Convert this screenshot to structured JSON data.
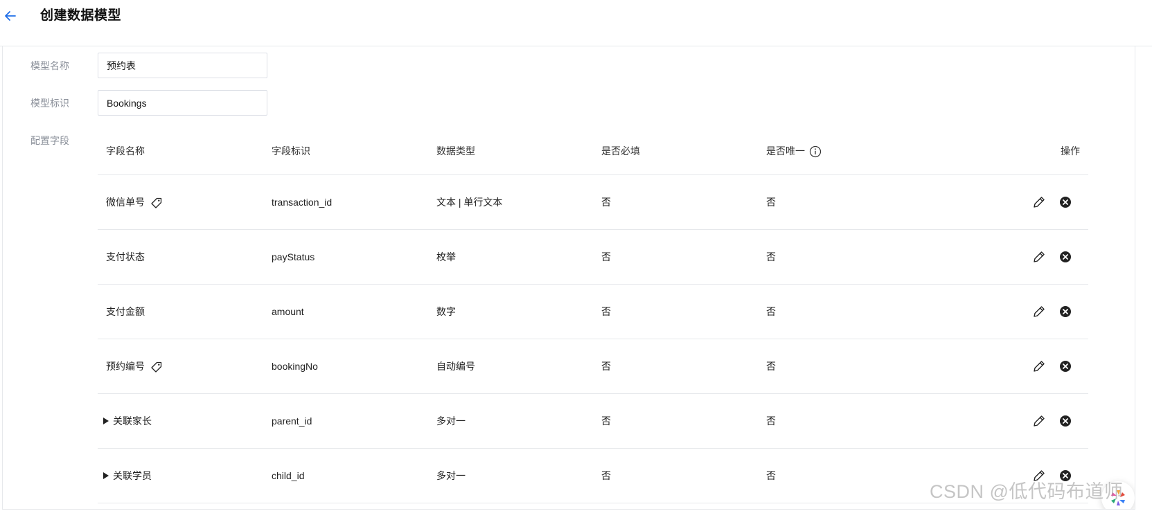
{
  "header": {
    "title": "创建数据模型",
    "back_icon": "arrow-left-icon"
  },
  "form": {
    "model_name": {
      "label": "模型名称",
      "value": "预约表"
    },
    "model_id": {
      "label": "模型标识",
      "value": "Bookings"
    },
    "fields_label": "配置字段"
  },
  "table": {
    "columns": {
      "name": "字段名称",
      "id": "字段标识",
      "type": "数据类型",
      "required": "是否必填",
      "unique": "是否唯一",
      "ops": "操作"
    },
    "rows": [
      {
        "name": "微信单号",
        "id": "transaction_id",
        "type": "文本 | 单行文本",
        "required": "否",
        "unique": "否",
        "tag": true,
        "expandable": false
      },
      {
        "name": "支付状态",
        "id": "payStatus",
        "type": "枚举",
        "required": "否",
        "unique": "否",
        "tag": false,
        "expandable": false
      },
      {
        "name": "支付金额",
        "id": "amount",
        "type": "数字",
        "required": "否",
        "unique": "否",
        "tag": false,
        "expandable": false
      },
      {
        "name": "预约编号",
        "id": "bookingNo",
        "type": "自动编号",
        "required": "否",
        "unique": "否",
        "tag": true,
        "expandable": false
      },
      {
        "name": "关联家长",
        "id": "parent_id",
        "type": "多对一",
        "required": "否",
        "unique": "否",
        "tag": false,
        "expandable": true
      },
      {
        "name": "关联学员",
        "id": "child_id",
        "type": "多对一",
        "required": "否",
        "unique": "否",
        "tag": false,
        "expandable": true
      }
    ]
  },
  "watermark": "CSDN @低代码布道师",
  "colors": {
    "accent": "#1f6ee8",
    "border": "#e6e8eb",
    "label": "#8a8f99"
  }
}
